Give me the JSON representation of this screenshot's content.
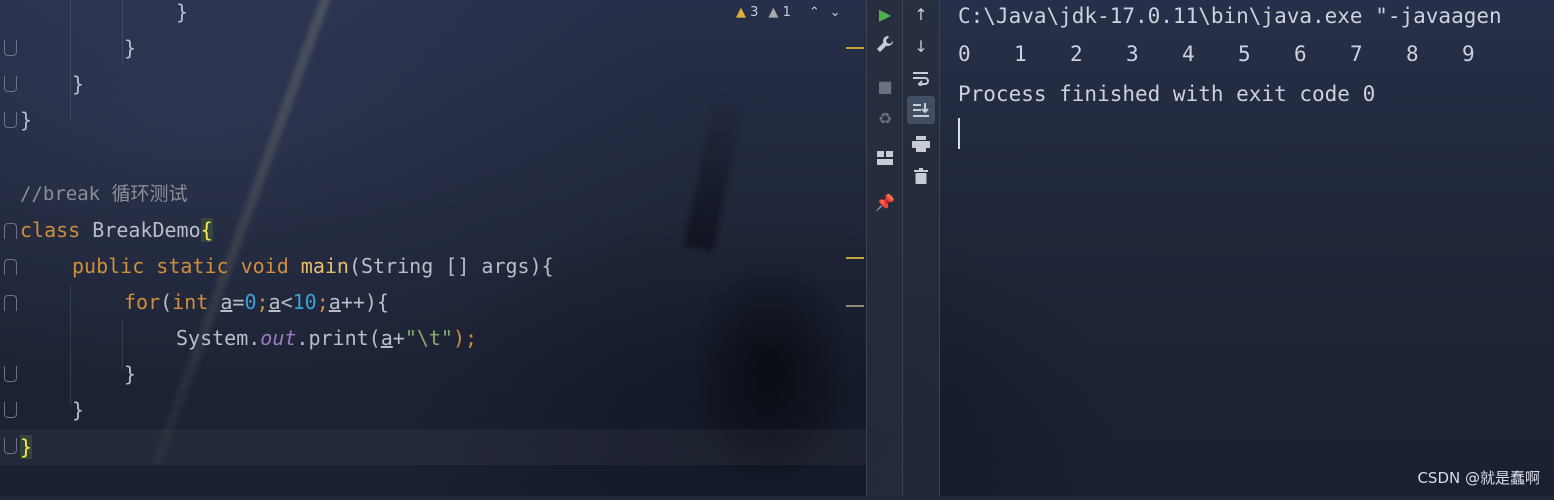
{
  "editor": {
    "lines": [
      {
        "id": "l1",
        "text": "}"
      },
      {
        "id": "l2",
        "text": "}"
      },
      {
        "id": "l3",
        "text": "}"
      },
      {
        "id": "l4",
        "text": "}"
      },
      {
        "id": "l5",
        "text": "//break 循环测试"
      },
      {
        "id": "l6_kw",
        "text": "class"
      },
      {
        "id": "l6_name",
        "text": " BreakDemo"
      },
      {
        "id": "l6_brace",
        "text": "{"
      },
      {
        "id": "l7_kw",
        "text": "public static void "
      },
      {
        "id": "l7_fn",
        "text": "main"
      },
      {
        "id": "l7_rest",
        "text": "(String [] args){"
      },
      {
        "id": "l8_kw",
        "text": "for"
      },
      {
        "id": "l8_p",
        "text": "("
      },
      {
        "id": "l8_int",
        "text": "int "
      },
      {
        "id": "l8_a1",
        "text": "a"
      },
      {
        "id": "l8_eq",
        "text": "="
      },
      {
        "id": "l8_n0",
        "text": "0"
      },
      {
        "id": "l8_s1",
        "text": ";"
      },
      {
        "id": "l8_a2",
        "text": "a"
      },
      {
        "id": "l8_lt",
        "text": "<"
      },
      {
        "id": "l8_n10",
        "text": "10"
      },
      {
        "id": "l8_s2",
        "text": ";"
      },
      {
        "id": "l8_a3",
        "text": "a"
      },
      {
        "id": "l8_end",
        "text": "++){"
      },
      {
        "id": "l9_sys",
        "text": "System."
      },
      {
        "id": "l9_out",
        "text": "out"
      },
      {
        "id": "l9_print",
        "text": ".print("
      },
      {
        "id": "l9_a",
        "text": "a"
      },
      {
        "id": "l9_plus",
        "text": "+"
      },
      {
        "id": "l9_str",
        "text": "\"\\t\""
      },
      {
        "id": "l9_end",
        "text": ");"
      },
      {
        "id": "l10",
        "text": "}"
      },
      {
        "id": "l11",
        "text": "}"
      },
      {
        "id": "l12",
        "text": "}"
      }
    ],
    "inspections": {
      "warnings": "3",
      "weak_warnings": "1"
    }
  },
  "run_toolbar": {
    "rerun_icon": "play-icon",
    "settings_icon": "wrench-icon",
    "stop_icon": "stop-icon",
    "layout_icon": "layout-icon",
    "pin_icon": "pin-icon"
  },
  "console_toolbar": {
    "up_icon": "arrow-up-icon",
    "down_icon": "arrow-down-icon",
    "wrap_icon": "soft-wrap-icon",
    "scroll_icon": "scroll-to-end-icon",
    "print_icon": "print-icon",
    "clear_icon": "trash-icon"
  },
  "console": {
    "command": "C:\\Java\\jdk-17.0.11\\bin\\java.exe \"-javaagen",
    "output_numbers": [
      "0",
      "1",
      "2",
      "3",
      "4",
      "5",
      "6",
      "7",
      "8",
      "9"
    ],
    "finish_message": "Process finished with exit code 0"
  },
  "watermark": "CSDN @就是蠢啊",
  "colors": {
    "keyword": "#cf8e3a",
    "function": "#e8c06b",
    "number": "#3ea1d8",
    "string": "#8aa96b",
    "field": "#9b7bc0",
    "comment": "#8a8f99",
    "run_green": "#4caf50"
  }
}
